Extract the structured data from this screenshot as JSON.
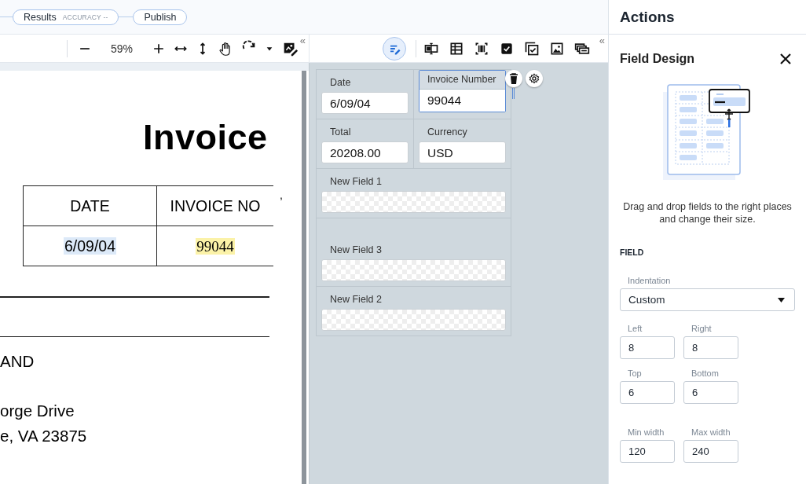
{
  "pipeline": {
    "steps": [
      {
        "label": "Results",
        "badge": "ACCURACY --"
      },
      {
        "label": "Publish"
      }
    ]
  },
  "doc_toolbar": {
    "zoom": "59%",
    "collapse": "«"
  },
  "field_toolbar": {
    "tools": [
      {
        "selected": true
      },
      {
        "selected": false
      },
      {
        "selected": false
      },
      {
        "selected": false
      },
      {
        "selected": false
      },
      {
        "selected": false
      },
      {
        "selected": false
      },
      {
        "selected": false
      }
    ],
    "collapse": "«"
  },
  "document": {
    "title": "Invoice",
    "table": {
      "columns": [
        "DATE",
        "INVOICE NO"
      ],
      "cells": [
        {
          "text": "6/09/04",
          "color": "#dce9f8"
        },
        {
          "text": "99044",
          "color": "#fbf2a8"
        }
      ],
      "mark": ","
    },
    "lines": [
      "AND",
      "orge Drive",
      "e, VA 23875"
    ]
  },
  "field_rows": [
    {
      "fields": [
        {
          "label": "Date",
          "value": "6/09/04",
          "kind": "text",
          "selected": false
        },
        {
          "label": "Invoice Number",
          "value": "99044",
          "kind": "text",
          "selected": true
        }
      ]
    },
    {
      "fields": [
        {
          "label": "Total",
          "value": "20208.00",
          "kind": "text",
          "selected": false
        },
        {
          "label": "Currency",
          "value": "USD",
          "kind": "text",
          "selected": false
        }
      ]
    },
    {
      "fields": [
        {
          "label": "New Field 1",
          "kind": "empty",
          "selected": false
        }
      ]
    },
    {
      "fields": [
        {
          "label": "New Field 3",
          "kind": "empty",
          "selected": false
        }
      ]
    },
    {
      "fields": [
        {
          "label": "New Field 2",
          "kind": "empty",
          "selected": false
        }
      ]
    }
  ],
  "actions": {
    "title": "Actions",
    "section": "Field Design",
    "description": "Drag and drop fields to the right places and change their size.",
    "group": "FIELD",
    "indentation": {
      "label": "Indentation",
      "value": "Custom"
    },
    "pairs": [
      [
        {
          "label": "Left",
          "value": "8"
        },
        {
          "label": "Right",
          "value": "8"
        }
      ],
      [
        {
          "label": "Top",
          "value": "6"
        },
        {
          "label": "Bottom",
          "value": "6"
        }
      ],
      [
        {
          "label": "Min width",
          "value": "120"
        },
        {
          "label": "Max width",
          "value": "240"
        }
      ]
    ]
  }
}
